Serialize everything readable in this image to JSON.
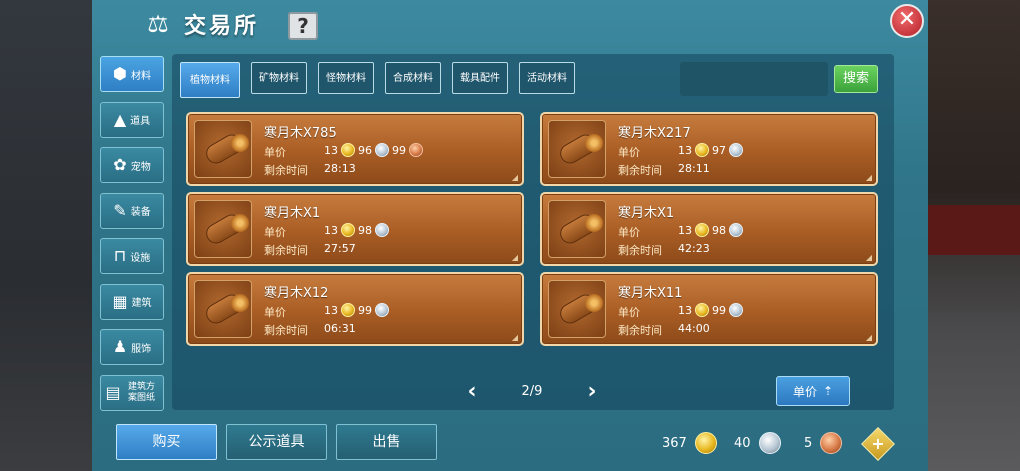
{
  "title": "交易所",
  "help_label": "?",
  "close_label": "✕",
  "sidebar": [
    {
      "label": "材料",
      "icon": "materials-icon",
      "glyph": "⬢",
      "active": true
    },
    {
      "label": "道具",
      "icon": "item-icon",
      "glyph": "▲",
      "active": false
    },
    {
      "label": "宠物",
      "icon": "paw-icon",
      "glyph": "✿",
      "active": false
    },
    {
      "label": "装备",
      "icon": "equipment-icon",
      "glyph": "✎",
      "active": false
    },
    {
      "label": "设施",
      "icon": "facility-icon",
      "glyph": "⊓",
      "active": false
    },
    {
      "label": "建筑",
      "icon": "building-icon",
      "glyph": "▦",
      "active": false
    },
    {
      "label": "服饰",
      "icon": "clothing-icon",
      "glyph": "♟",
      "active": false
    },
    {
      "label": "建筑方案图纸",
      "icon": "blueprint-icon",
      "glyph": "▤",
      "active": false
    }
  ],
  "tabs": [
    {
      "label": "植物材料",
      "active": true
    },
    {
      "label": "矿物材料",
      "active": false
    },
    {
      "label": "怪物材料",
      "active": false
    },
    {
      "label": "合成材料",
      "active": false
    },
    {
      "label": "载具配件",
      "active": false
    },
    {
      "label": "活动材料",
      "active": false
    }
  ],
  "search": {
    "value": "",
    "button_label": "搜索"
  },
  "labels": {
    "unit_price": "单价",
    "remaining_time": "剩余时间"
  },
  "listings": [
    {
      "name": "寒月木X785",
      "gold": "13",
      "silver": "96",
      "copper": "99",
      "time": "28:13"
    },
    {
      "name": "寒月木X217",
      "gold": "13",
      "silver": "97",
      "copper": null,
      "time": "28:11"
    },
    {
      "name": "寒月木X1",
      "gold": "13",
      "silver": "98",
      "copper": null,
      "time": "27:57"
    },
    {
      "name": "寒月木X1",
      "gold": "13",
      "silver": "98",
      "copper": null,
      "time": "42:23"
    },
    {
      "name": "寒月木X12",
      "gold": "13",
      "silver": "99",
      "copper": null,
      "time": "06:31"
    },
    {
      "name": "寒月木X11",
      "gold": "13",
      "silver": "99",
      "copper": null,
      "time": "44:00"
    }
  ],
  "pager": {
    "text": "2/9",
    "prev": "‹",
    "next": "›"
  },
  "sort_button": {
    "label": "单价",
    "glyph": "⇡"
  },
  "bottom_tabs": [
    {
      "label": "购买",
      "active": true
    },
    {
      "label": "公示道具",
      "active": false
    },
    {
      "label": "出售",
      "active": false
    }
  ],
  "currency": {
    "gold": "367",
    "silver": "40",
    "copper": "5"
  },
  "colors": {
    "gold": "#e8b820",
    "silver": "#b7c7d4",
    "copper": "#d77a48",
    "card": "#a95d24",
    "accent_blue": "#3f8fd6",
    "search_green": "#4cb84a"
  }
}
